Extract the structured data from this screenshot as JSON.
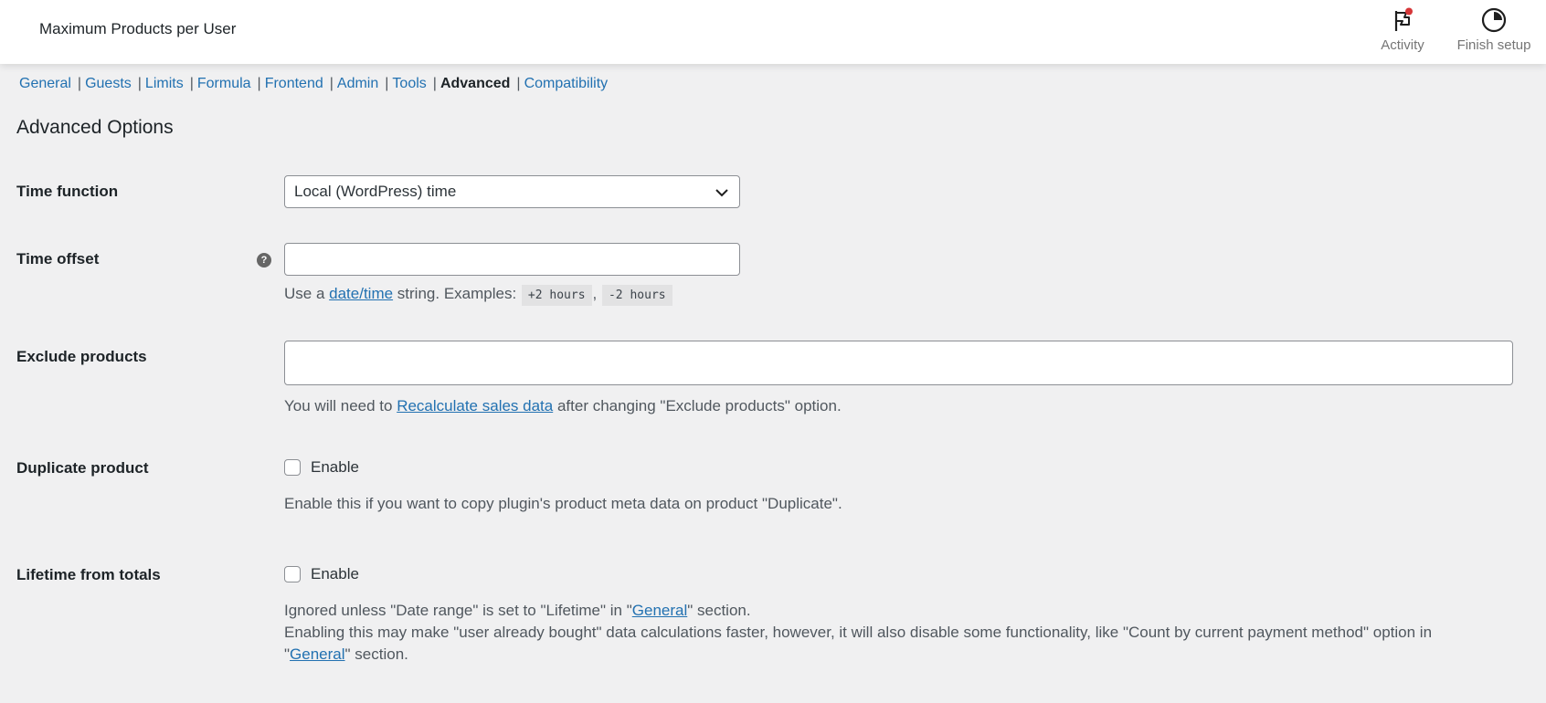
{
  "header": {
    "title": "Maximum Products per User",
    "actions": [
      {
        "label": "Activity",
        "icon": "flag-icon",
        "badge_color": "#d63638"
      },
      {
        "label": "Finish setup",
        "icon": "progress-circle-icon"
      }
    ]
  },
  "subnav": {
    "items": [
      {
        "label": "General",
        "current": false
      },
      {
        "label": "Guests",
        "current": false
      },
      {
        "label": "Limits",
        "current": false
      },
      {
        "label": "Formula",
        "current": false
      },
      {
        "label": "Frontend",
        "current": false
      },
      {
        "label": "Admin",
        "current": false
      },
      {
        "label": "Tools",
        "current": false
      },
      {
        "label": "Advanced",
        "current": true
      },
      {
        "label": "Compatibility",
        "current": false
      }
    ],
    "separator": "|"
  },
  "section": {
    "title": "Advanced Options"
  },
  "fields": {
    "time_function": {
      "label": "Time function",
      "selected": "Local (WordPress) time"
    },
    "time_offset": {
      "label": "Time offset",
      "help_glyph": "?",
      "value": "",
      "desc_prefix": "Use a ",
      "desc_link": "date/time",
      "desc_middle": " string. Examples: ",
      "example_1": "+2 hours",
      "example_sep": ", ",
      "example_2": "-2 hours"
    },
    "exclude_products": {
      "label": "Exclude products",
      "value": "",
      "desc_prefix": "You will need to ",
      "desc_link": "Recalculate sales data",
      "desc_suffix": " after changing \"Exclude products\" option."
    },
    "duplicate_product": {
      "label": "Duplicate product",
      "checkbox_label": "Enable",
      "checked": false,
      "desc": "Enable this if you want to copy plugin's product meta data on product \"Duplicate\"."
    },
    "lifetime_from_totals": {
      "label": "Lifetime from totals",
      "checkbox_label": "Enable",
      "checked": false,
      "desc1_prefix": "Ignored unless \"Date range\" is set to \"Lifetime\" in \"",
      "desc1_link": "General",
      "desc1_suffix": "\" section.",
      "desc2": "Enabling this may make \"user already bought\" data calculations faster, however, it will also disable some functionality, like \"Count by current payment method\" option in",
      "desc3_prefix": "\"",
      "desc3_link": "General",
      "desc3_suffix": "\" section."
    }
  }
}
